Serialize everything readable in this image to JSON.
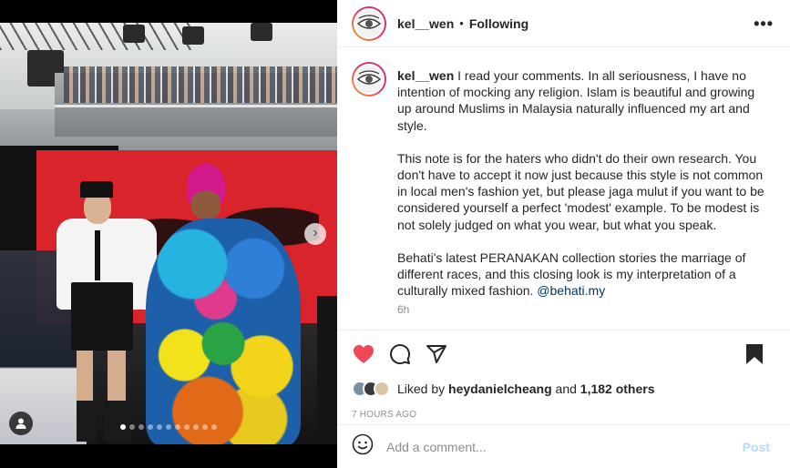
{
  "post": {
    "author": "kel__wen",
    "separator": "•",
    "follow_status": "Following",
    "more_icon": "more-horizontal-icon"
  },
  "caption": {
    "username": "kel__wen",
    "paragraph1": " I read your comments. In all seriousness, I have no intention of mocking any religion. Islam is beautiful and growing up around Muslims in Malaysia naturally influenced my art and style.",
    "paragraph2": "This note is for the haters who didn't do their own research. You don't have to accept it now just because this style is not common in local men's fashion yet, but please jaga mulut if you want to be considered yourself a perfect 'modest' example. To be modest is not solely judged on what you wear, but what you speak.",
    "paragraph3": "Behati's latest PERANAKAN collection stories the marriage of different races, and this closing look is my interpretation of a culturally mixed fashion. ",
    "mention": "@behati.my",
    "time": "6h"
  },
  "actions": {
    "like_icon": "heart-filled-icon",
    "comment_icon": "comment-icon",
    "share_icon": "share-icon",
    "save_icon": "bookmark-filled-icon",
    "like_color": "#ed4956"
  },
  "likes": {
    "prefix": "Liked by ",
    "user": "heydanielcheang",
    "middle": " and ",
    "others": "1,182 others"
  },
  "timestamp": "7 HOURS AGO",
  "comment": {
    "placeholder": "Add a comment...",
    "post_label": "Post",
    "emoji_icon": "smiley-icon"
  },
  "carousel": {
    "total": 11,
    "active": 0,
    "next_icon": "chevron-right-icon"
  }
}
